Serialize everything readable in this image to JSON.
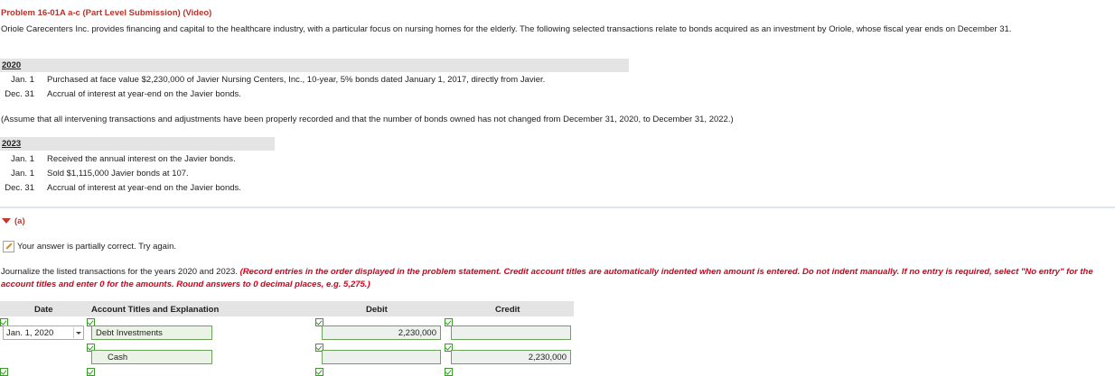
{
  "problem": {
    "title": "Problem 16-01A a-c (Part Level Submission) (Video)",
    "intro": "Oriole Carecenters Inc. provides financing and capital to the healthcare industry, with a particular focus on nursing homes for the elderly. The following selected transactions relate to bonds acquired as an investment by Oriole, whose fiscal year ends on December 31."
  },
  "years": [
    {
      "year": "2020",
      "transactions": [
        {
          "date": "Jan. 1",
          "text": "Purchased at face value $2,230,000 of Javier Nursing Centers, Inc., 10-year, 5% bonds dated January 1, 2017, directly from Javier."
        },
        {
          "date": "Dec. 31",
          "text": "Accrual of interest at year-end on the Javier bonds."
        }
      ]
    },
    {
      "year": "2023",
      "transactions": [
        {
          "date": "Jan. 1",
          "text": "Received the annual interest on the Javier bonds."
        },
        {
          "date": "Jan. 1",
          "text": "Sold $1,115,000 Javier bonds at 107."
        },
        {
          "date": "Dec. 31",
          "text": "Accrual of interest at year-end on the Javier bonds."
        }
      ]
    }
  ],
  "assumption": "(Assume that all intervening transactions and adjustments have been properly recorded and that the number of bonds owned has not changed from December 31, 2020, to December 31, 2022.)",
  "part_a": {
    "label": "(a)",
    "status": "Your answer is partially correct.  Try again.",
    "instruction_plain": "Journalize the listed transactions for the years 2020 and 2023. ",
    "instruction_red": "(Record entries in the order displayed in the problem statement. Credit account titles are automatically indented when amount is entered. Do not indent manually. If no entry is required, select \"No entry\" for the account titles and enter 0 for the amounts. Round answers to 0 decimal places, e.g. 5,275.)"
  },
  "table": {
    "headers": {
      "date": "Date",
      "account": "Account Titles and Explanation",
      "debit": "Debit",
      "credit": "Credit"
    },
    "rows": [
      {
        "date": "Jan. 1, 2020",
        "account": "Debt Investments",
        "debit": "2,230,000",
        "credit": ""
      },
      {
        "date": "",
        "account": "Cash",
        "debit": "",
        "credit": "2,230,000"
      }
    ]
  },
  "colors": {
    "title": "#b5332a",
    "instruction_red": "#d0021b",
    "field_border": "#6ca35a",
    "check": "#3a9a2a"
  }
}
